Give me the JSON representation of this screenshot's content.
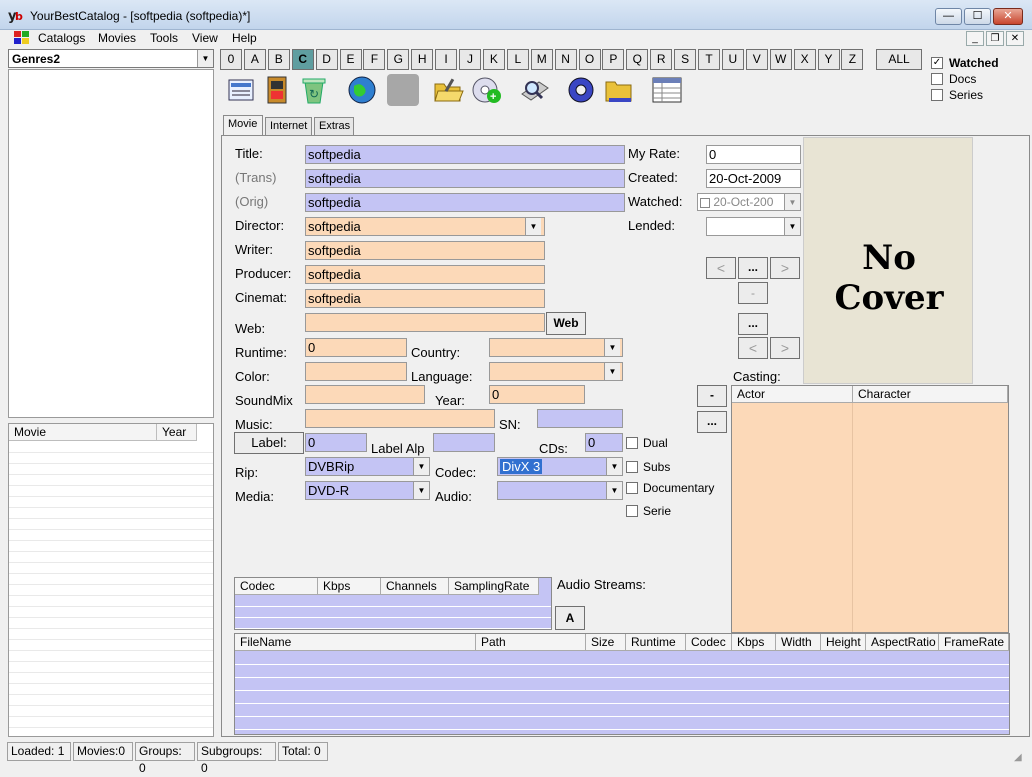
{
  "window": {
    "title": "YourBestCatalog - [softpedia (softpedia)*]",
    "min": "—",
    "max": "☐",
    "close": "✕"
  },
  "menu": [
    "Catalogs",
    "Movies",
    "Tools",
    "View",
    "Help"
  ],
  "left": {
    "genre_value": "Genres2",
    "list_headers": [
      "Movie",
      "Year"
    ]
  },
  "letters": [
    "0",
    "A",
    "B",
    "C",
    "D",
    "E",
    "F",
    "G",
    "H",
    "I",
    "J",
    "K",
    "L",
    "M",
    "N",
    "O",
    "P",
    "Q",
    "R",
    "S",
    "T",
    "U",
    "V",
    "W",
    "X",
    "Y",
    "Z"
  ],
  "active_letter": "C",
  "all_label": "ALL",
  "filters": [
    {
      "label": "Watched",
      "checked": true
    },
    {
      "label": "Docs",
      "checked": false
    },
    {
      "label": "Series",
      "checked": false
    }
  ],
  "tabs": [
    "Movie",
    "Internet",
    "Extras"
  ],
  "form": {
    "title_label": "Title:",
    "title": "softpedia",
    "trans_label": "(Trans)",
    "trans": "softpedia",
    "orig_label": "(Orig)",
    "orig": "softpedia",
    "director_label": "Director:",
    "director": "softpedia",
    "writer_label": "Writer:",
    "writer": "softpedia",
    "producer_label": "Producer:",
    "producer": "softpedia",
    "cinemat_label": "Cinemat:",
    "cinemat": "softpedia",
    "web_label": "Web:",
    "web_button": "Web",
    "runtime_label": "Runtime:",
    "runtime": "0",
    "country_label": "Country:",
    "color_label": "Color:",
    "language_label": "Language:",
    "soundmix_label": "SoundMix",
    "year_label": "Year:",
    "year": "0",
    "music_label": "Music:",
    "sn_label": "SN:",
    "label_button": "Label:",
    "label_value": "0",
    "label_alp": "Label Alp",
    "cds_label": "CDs:",
    "cds": "0",
    "rip_label": "Rip:",
    "rip": "DVBRip",
    "codec_label": "Codec:",
    "codec": "DivX 3",
    "media_label": "Media:",
    "media": "DVD-R",
    "audio_label": "Audio:",
    "dual": "Dual",
    "subs": "Subs",
    "documentary": "Documentary",
    "serie": "Serie",
    "myrate_label": "My Rate:",
    "myrate": "0",
    "created_label": "Created:",
    "created": "20-Oct-2009",
    "watched_label": "Watched:",
    "watched": "20-Oct-200",
    "lended_label": "Lended:",
    "nav_prev": "<",
    "nav_more": "...",
    "nav_next": ">",
    "minus": "-",
    "dots": "...",
    "cover_text": "No Cover",
    "casting_label": "Casting:",
    "casting_minus": "-",
    "casting_dots": "...",
    "audio_streams_label": "Audio Streams:",
    "audio_a_button": "A"
  },
  "cast_headers": [
    "Actor",
    "Character"
  ],
  "audio_headers": [
    "Codec",
    "Kbps",
    "Channels",
    "SamplingRate"
  ],
  "file_headers": [
    "FileName",
    "Path",
    "Size",
    "Runtime",
    "Codec",
    "Kbps",
    "Width",
    "Height",
    "AspectRatio",
    "FrameRate"
  ],
  "status": [
    "Loaded: 1",
    "Movies:0",
    "Groups: 0",
    "Subgroups: 0",
    "Total: 0"
  ],
  "colors": {
    "field_blue": "#c4c4f4",
    "field_orange": "#fcd9b8",
    "active_letter": "#5f9ea0"
  }
}
